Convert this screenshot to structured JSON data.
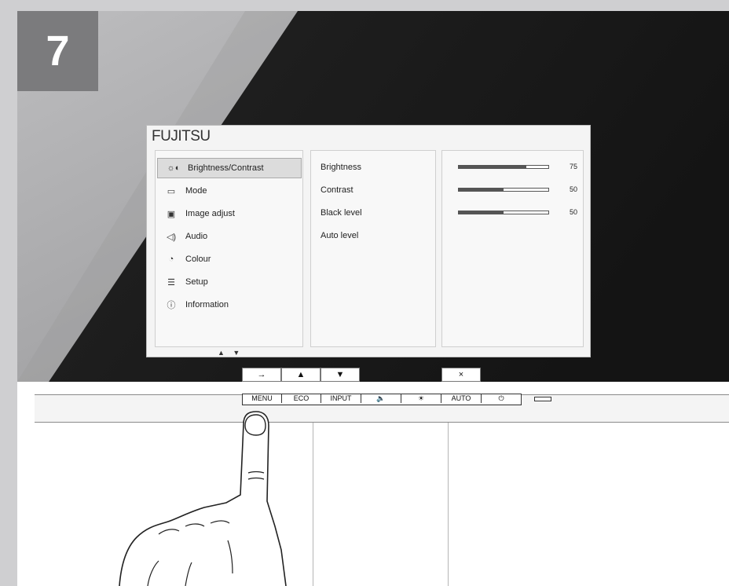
{
  "step": {
    "number": "7"
  },
  "osd": {
    "brand": "FUJITSU",
    "menu": [
      {
        "label": "Brightness/Contrast",
        "icon": "brightness-contrast-icon",
        "selected": true
      },
      {
        "label": "Mode",
        "icon": "mode-icon"
      },
      {
        "label": "Image adjust",
        "icon": "image-adjust-icon"
      },
      {
        "label": "Audio",
        "icon": "speaker-icon"
      },
      {
        "label": "Colour",
        "icon": "colour-palette-icon"
      },
      {
        "label": "Setup",
        "icon": "setup-sliders-icon"
      },
      {
        "label": "Information",
        "icon": "information-icon"
      }
    ],
    "submenu": [
      {
        "label": "Brightness",
        "value": "75",
        "level": 75
      },
      {
        "label": "Contrast",
        "value": "50",
        "level": 50
      },
      {
        "label": "Black level",
        "value": "50",
        "level": 50
      },
      {
        "label": "Auto level"
      }
    ],
    "nav_hint": "▲ ▼"
  },
  "softkeys": [
    "→",
    "▲",
    "▼",
    "×"
  ],
  "buttons": [
    "MENU",
    "ECO",
    "INPUT",
    "🔈",
    "☀",
    "AUTO",
    "⏻"
  ],
  "colors": {
    "screen_dark": "#1c1c1c",
    "screen_light": "#a7a7a9",
    "step_box": "#7b7b7d"
  }
}
